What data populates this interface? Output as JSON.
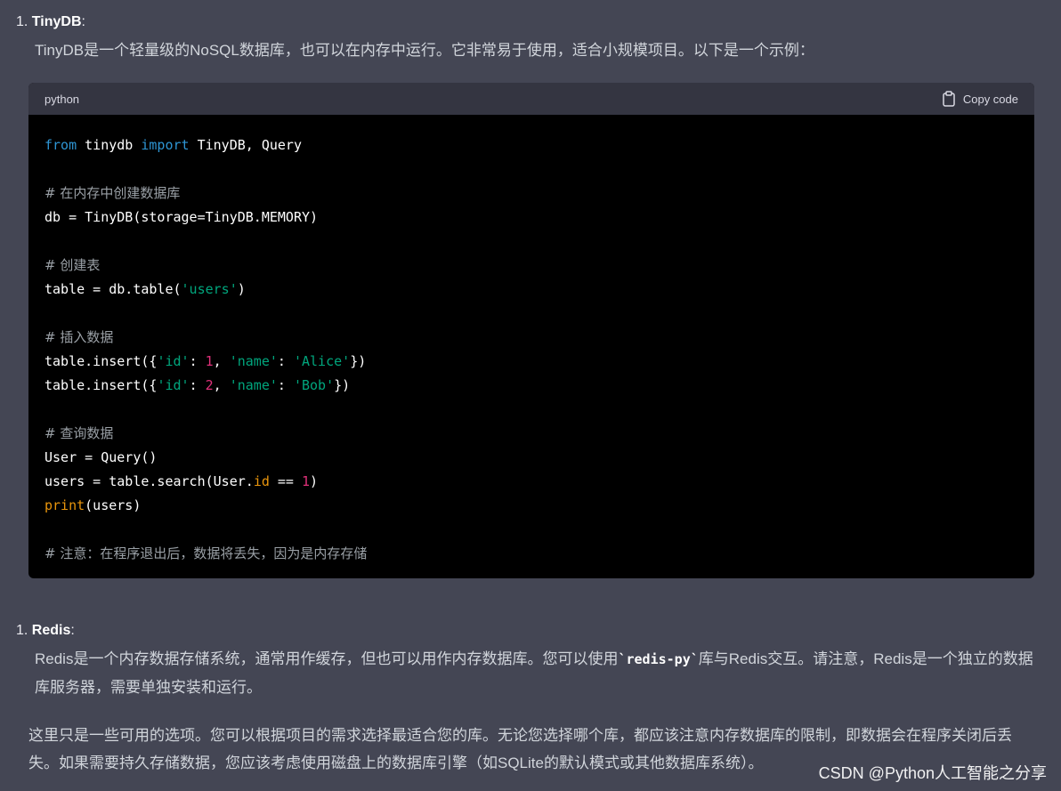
{
  "item1": {
    "number": "1.",
    "title": "TinyDB",
    "colon": ":",
    "description": "TinyDB是一个轻量级的NoSQL数据库，也可以在内存中运行。它非常易于使用，适合小规模项目。以下是一个示例："
  },
  "code_block": {
    "language": "python",
    "copy_label": "Copy code",
    "icon": "clipboard-icon"
  },
  "code": {
    "l1_from": "from",
    "l1_mod": " tinydb ",
    "l1_import": "import",
    "l1_rest": " TinyDB, Query",
    "l2_comment": "# 在内存中创建数据库",
    "l3": "db = TinyDB(storage=TinyDB.MEMORY)",
    "l4_comment": "# 创建表",
    "l5_a": "table = db.table(",
    "l5_str": "'users'",
    "l5_b": ")",
    "l6_comment": "# 插入数据",
    "l7_a": "table.insert({",
    "l7_k1": "'id'",
    "l7_sep1": ": ",
    "l7_v1": "1",
    "l7_sep2": ", ",
    "l7_k2": "'name'",
    "l7_sep3": ": ",
    "l7_v2": "'Alice'",
    "l7_b": "})",
    "l8_a": "table.insert({",
    "l8_k1": "'id'",
    "l8_sep1": ": ",
    "l8_v1": "2",
    "l8_sep2": ", ",
    "l8_k2": "'name'",
    "l8_sep3": ": ",
    "l8_v2": "'Bob'",
    "l8_b": "})",
    "l9_comment": "# 查询数据",
    "l10": "User = Query()",
    "l11_a": "users = table.search(User.",
    "l11_attr": "id",
    "l11_b": " == ",
    "l11_num": "1",
    "l11_c": ")",
    "l12_fn": "print",
    "l12_rest": "(users)",
    "l13_comment": "# 注意：在程序退出后，数据将丢失，因为是内存存储"
  },
  "item2": {
    "number": "1.",
    "title": "Redis",
    "colon": ":",
    "desc_a": "Redis是一个内存数据存储系统，通常用作缓存，但也可以用作内存数据库。您可以使用",
    "desc_code": "`redis-py`",
    "desc_b": "库与Redis交互。请注意，Redis是一个独立的数据库服务器，需要单独安装和运行。"
  },
  "closing_paragraph": "这里只是一些可用的选项。您可以根据项目的需求选择最适合您的库。无论您选择哪个库，都应该注意内存数据库的限制，即数据会在程序关闭后丢失。如果需要持久存储数据，您应该考虑使用磁盘上的数据库引擎（如SQLite的默认模式或其他数据库系统）。",
  "watermark": "CSDN @Python人工智能之分享"
}
